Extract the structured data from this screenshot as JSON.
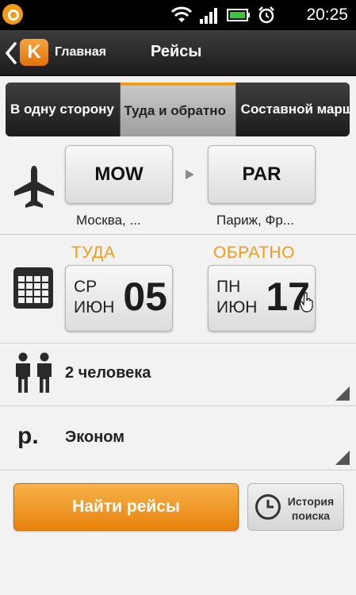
{
  "status_bar": {
    "time": "20:25",
    "icons": [
      "app-notification-icon",
      "wifi-icon",
      "signal-icon",
      "battery-icon",
      "alarm-icon"
    ]
  },
  "action_bar": {
    "logo_letter": "K",
    "home_label": "Главная",
    "title": "Рейсы"
  },
  "trip_tabs": [
    {
      "label": "В одну сторону",
      "selected": false
    },
    {
      "label": "Туда и обратно",
      "selected": true
    },
    {
      "label": "Составной маршрут",
      "selected": false
    }
  ],
  "route": {
    "origin_code": "MOW",
    "origin_city": "Москва, ...",
    "destination_code": "PAR",
    "destination_city": "Париж, Фр..."
  },
  "dates": {
    "outbound": {
      "label": "ТУДА",
      "weekday": "СР",
      "month": "ИЮН",
      "day": "05"
    },
    "return": {
      "label": "ОБРАТНО",
      "weekday": "ПН",
      "month": "ИЮН",
      "day": "17"
    }
  },
  "passengers": {
    "value": "2 человека"
  },
  "cabin_class": {
    "currency_symbol": "р.",
    "value": "Эконом"
  },
  "actions": {
    "search_label": "Найти рейсы",
    "history_line1": "История",
    "history_line2": "поиска"
  },
  "colors": {
    "accent": "#f39a16",
    "background": "#f2f2f2",
    "actionbar": "#1c1c1c"
  }
}
